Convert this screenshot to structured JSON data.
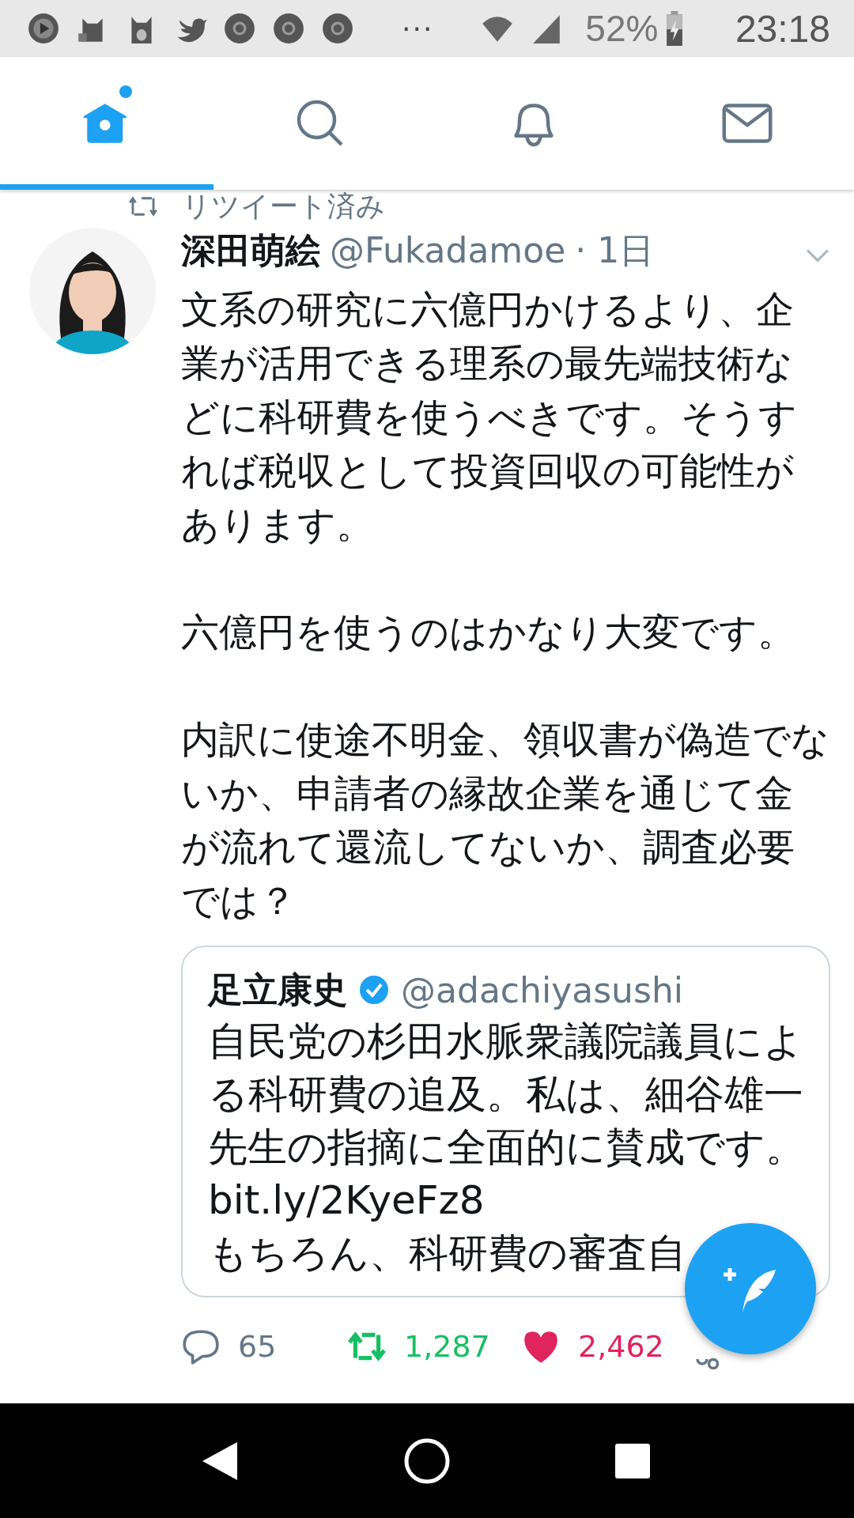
{
  "status_bar": {
    "overflow": "···",
    "battery": "52%",
    "time": "23:18"
  },
  "tabs": [
    {
      "kind": "home",
      "selected": true,
      "badge": true
    },
    {
      "kind": "search",
      "selected": false,
      "badge": false
    },
    {
      "kind": "bell",
      "selected": false,
      "badge": false
    },
    {
      "kind": "mail",
      "selected": false,
      "badge": false
    }
  ],
  "retweet_label": "リツイート済み",
  "tweet": {
    "name": "深田萌絵",
    "handle": "@Fukadamoe",
    "time": "· 1日",
    "paragraphs": [
      "文系の研究に六億円かけるより、企業が活用できる理系の最先端技術などに科研費を使うべきです。そうすれば税収として投資回収の可能性があります。",
      "六億円を使うのはかなり大変です。",
      "内訳に使途不明金、領収書が偽造でないか、申請者の縁故企業を通じて金が流れて還流してないか、調査必要では？"
    ],
    "quote": {
      "name": "足立康史",
      "verified": true,
      "handle": "@adachiyasushi",
      "lines": [
        "自民党の杉田水脈衆議院議員による科研費の追及。私は、細谷雄一先生の指摘に全面的に賛成です。bit.ly/2KyeFz8",
        "もちろん、科研費の審査自"
      ]
    },
    "replies": "65",
    "retweets": "1,287",
    "retweeted": true,
    "likes": "2,462",
    "liked": true
  }
}
